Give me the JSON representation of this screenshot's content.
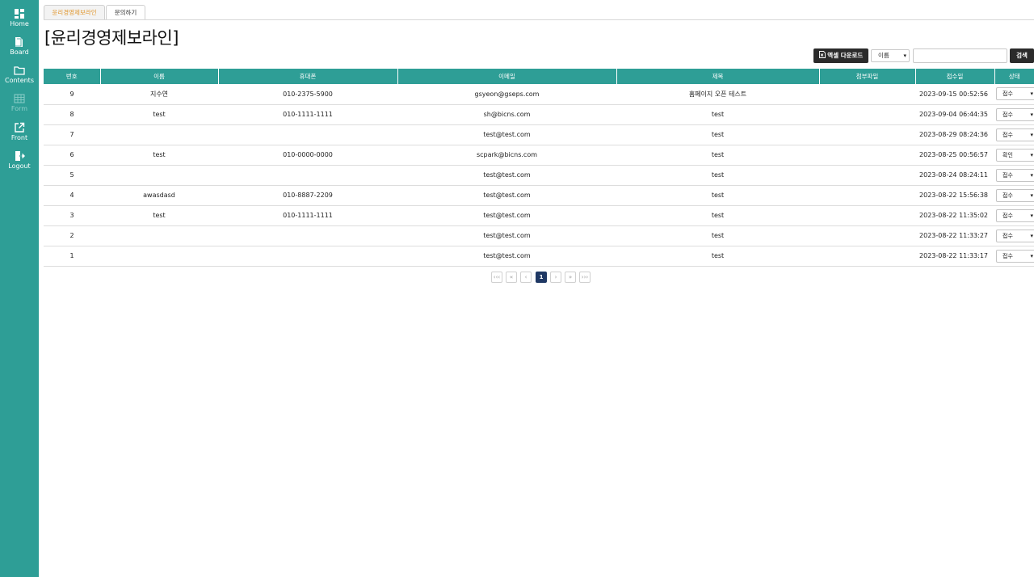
{
  "sidebar": {
    "items": [
      {
        "label": "Home",
        "icon": "dashboard-icon"
      },
      {
        "label": "Board",
        "icon": "document-icon"
      },
      {
        "label": "Contents",
        "icon": "folder-icon"
      },
      {
        "label": "Form",
        "icon": "table-icon"
      },
      {
        "label": "Front",
        "icon": "external-link-icon"
      },
      {
        "label": "Logout",
        "icon": "logout-icon"
      }
    ]
  },
  "tabs": [
    {
      "label": "윤리경영제보라인",
      "active": true
    },
    {
      "label": "문의하기",
      "active": false
    }
  ],
  "page_title": "[윤리경영제보라인]",
  "toolbar": {
    "excel_label": "엑셀 다운로드",
    "search_field_selected": "이름",
    "search_value": "",
    "search_label": "검색"
  },
  "table": {
    "headers": [
      "번호",
      "이름",
      "휴대폰",
      "이메일",
      "제목",
      "첨부파일",
      "접수일",
      "상태"
    ],
    "rows": [
      {
        "no": "9",
        "name": "지수연",
        "phone": "010-2375-5900",
        "email": "gsyeon@gseps.com",
        "subject": "홈페이지 오픈 테스트",
        "attachment": "",
        "date": "2023-09-15 00:52:56",
        "status": "접수"
      },
      {
        "no": "8",
        "name": "test",
        "phone": "010-1111-1111",
        "email": "sh@bicns.com",
        "subject": "test",
        "attachment": "",
        "date": "2023-09-04 06:44:35",
        "status": "접수"
      },
      {
        "no": "7",
        "name": "",
        "phone": "",
        "email": "test@test.com",
        "subject": "test",
        "attachment": "",
        "date": "2023-08-29 08:24:36",
        "status": "접수"
      },
      {
        "no": "6",
        "name": "test",
        "phone": "010-0000-0000",
        "email": "scpark@bicns.com",
        "subject": "test",
        "attachment": "",
        "date": "2023-08-25 00:56:57",
        "status": "확인"
      },
      {
        "no": "5",
        "name": "",
        "phone": "",
        "email": "test@test.com",
        "subject": "test",
        "attachment": "",
        "date": "2023-08-24 08:24:11",
        "status": "접수"
      },
      {
        "no": "4",
        "name": "awasdasd",
        "phone": "010-8887-2209",
        "email": "test@test.com",
        "subject": "test",
        "attachment": "",
        "date": "2023-08-22 15:56:38",
        "status": "접수"
      },
      {
        "no": "3",
        "name": "test",
        "phone": "010-1111-1111",
        "email": "test@test.com",
        "subject": "test",
        "attachment": "",
        "date": "2023-08-22 11:35:02",
        "status": "접수"
      },
      {
        "no": "2",
        "name": "",
        "phone": "",
        "email": "test@test.com",
        "subject": "test",
        "attachment": "",
        "date": "2023-08-22 11:33:27",
        "status": "접수"
      },
      {
        "no": "1",
        "name": "",
        "phone": "",
        "email": "test@test.com",
        "subject": "test",
        "attachment": "",
        "date": "2023-08-22 11:33:17",
        "status": "접수"
      }
    ]
  },
  "pagination": {
    "first": "‹‹‹",
    "prev_block": "«",
    "prev": "‹",
    "current": "1",
    "next": "›",
    "next_block": "»",
    "last": "›››"
  },
  "colors": {
    "accent": "#2e9e96",
    "active_tab_text": "#e0962c",
    "pager_active": "#1f3864",
    "button_dark": "#2b2b2b"
  }
}
